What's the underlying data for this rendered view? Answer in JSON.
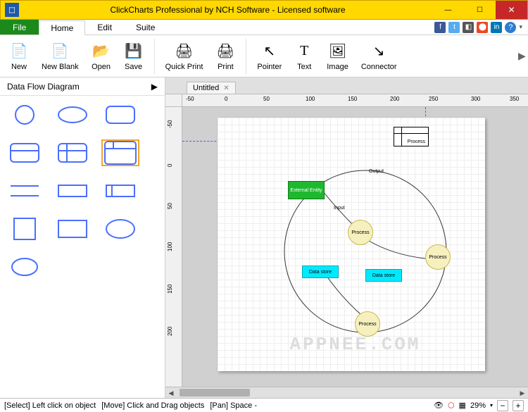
{
  "window": {
    "title": "ClickCharts Professional by NCH Software - Licensed software"
  },
  "menu": {
    "file": "File",
    "tabs": [
      "Home",
      "Edit",
      "Suite"
    ],
    "active": 0
  },
  "ribbon": {
    "buttons": [
      {
        "label": "New",
        "icon": "📄"
      },
      {
        "label": "New Blank",
        "icon": "📄"
      },
      {
        "label": "Open",
        "icon": "📂"
      },
      {
        "label": "Save",
        "icon": "💾"
      },
      {
        "label": "Quick Print",
        "icon": "🖨"
      },
      {
        "label": "Print",
        "icon": "🖨"
      },
      {
        "label": "Pointer",
        "icon": "↖"
      },
      {
        "label": "Text",
        "icon": "T"
      },
      {
        "label": "Image",
        "icon": "🖼"
      },
      {
        "label": "Connector",
        "icon": "↘"
      }
    ]
  },
  "shapePanel": {
    "title": "Data Flow Diagram"
  },
  "document": {
    "tab": "Untitled"
  },
  "ruler": {
    "h": [
      "-50",
      "0",
      "50",
      "100",
      "150",
      "200",
      "250",
      "300",
      "350"
    ],
    "v": [
      "-50",
      "0",
      "50",
      "100",
      "150",
      "200"
    ]
  },
  "diagram": {
    "watermark": "APPNEE.COM",
    "labels": {
      "externalEntity": "External Entity",
      "process": "Process",
      "dataStore": "Data store",
      "output": "Output",
      "input": "Input"
    }
  },
  "status": {
    "select": "[Select] Left click on object",
    "move": "[Move] Click and Drag objects",
    "pan": "[Pan] Space -",
    "zoom": "29%"
  }
}
